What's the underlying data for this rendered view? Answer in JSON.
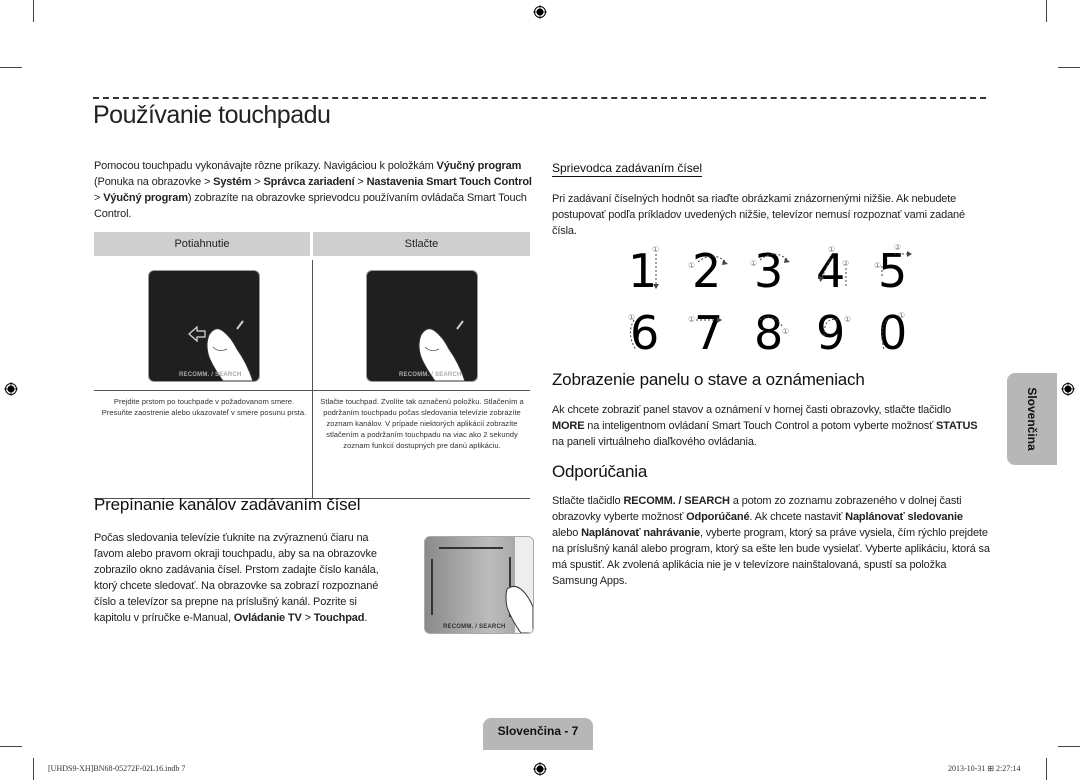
{
  "page": {
    "title": "Používanie touchpadu",
    "intro": {
      "parts": [
        {
          "t": "Pomocou touchpadu vykonávajte rôzne príkazy. Navigáciou k položkám ",
          "b": false
        },
        {
          "t": "Výučný program",
          "b": true
        },
        {
          "t": " (Ponuka na obrazovke > ",
          "b": false
        },
        {
          "t": "Systém",
          "b": true
        },
        {
          "t": " > ",
          "b": false
        },
        {
          "t": "Správca zariadení",
          "b": true
        },
        {
          "t": " > ",
          "b": false
        },
        {
          "t": "Nastavenia Smart Touch Control",
          "b": true
        },
        {
          "t": " > ",
          "b": false
        },
        {
          "t": "Výučný program",
          "b": true
        },
        {
          "t": ") zobrazíte na obrazovke sprievodcu používaním ovládača Smart Touch Control.",
          "b": false
        }
      ]
    },
    "gesture_table": {
      "headers": [
        "Potiahnutie",
        "Stlačte"
      ],
      "pad_label": "RECOMM. / SEARCH",
      "descriptions": [
        "Prejdite prstom po touchpade v požadovanom smere. Presuňte zaostrenie alebo ukazovateľ v smere posunu prsta.",
        "Stlačte touchpad. Zvolíte tak označenú položku. Stlačením a podržaním touchpadu počas sledovania televízie zobrazíte zoznam kanálov. V prípade niektorých aplikácií zobrazíte stlačením a podržaním touchpadu na viac ako 2 sekundy zoznam funkcií dostupných pre danú aplikáciu."
      ]
    },
    "channel_section": {
      "heading": "Prepínanie kanálov zadávaním čísel",
      "parts": [
        {
          "t": "Počas sledovania televízie ťuknite na zvýraznenú čiaru na ľavom alebo pravom okraji touchpadu, aby sa na obrazovke zobrazilo okno zadávania čísel. Prstom zadajte číslo kanála, ktorý chcete sledovať. Na obrazovke sa zobrazí rozpoznané číslo a televízor sa prepne na príslušný kanál. Pozrite si kapitolu v príručke e-Manual, ",
          "b": false
        },
        {
          "t": "Ovládanie TV",
          "b": true
        },
        {
          "t": " > ",
          "b": false
        },
        {
          "t": "Touchpad",
          "b": true
        },
        {
          "t": ".",
          "b": false
        }
      ],
      "pad_label": "RECOMM. / SEARCH"
    },
    "number_guide": {
      "heading": "Sprievodca zadávaním čísel",
      "text": "Pri zadávaní číselných hodnôt sa riaďte obrázkami znázornenými nižšie. Ak nebudete postupovať podľa príkladov uvedených nižšie, televízor nemusí rozpoznať vami zadané čísla.",
      "digits": [
        "1",
        "2",
        "3",
        "4",
        "5",
        "6",
        "7",
        "8",
        "9",
        "0"
      ],
      "stroke_markers": [
        "①",
        "②"
      ]
    },
    "status_section": {
      "heading": "Zobrazenie panelu o stave a oznámeniach",
      "parts": [
        {
          "t": "Ak chcete zobraziť panel stavov a oznámení v hornej časti obrazovky, stlačte tlačidlo ",
          "b": false
        },
        {
          "t": "MORE",
          "b": true
        },
        {
          "t": " na inteligentnom ovládaní Smart Touch Control a potom vyberte možnosť ",
          "b": false
        },
        {
          "t": "STATUS",
          "b": true
        },
        {
          "t": " na paneli virtuálneho diaľkového ovládania.",
          "b": false
        }
      ]
    },
    "recommend_section": {
      "heading": "Odporúčania",
      "parts": [
        {
          "t": "Stlačte tlačidlo ",
          "b": false
        },
        {
          "t": "RECOMM. / SEARCH",
          "b": true
        },
        {
          "t": " a potom zo zoznamu zobrazeného v dolnej časti obrazovky vyberte možnosť ",
          "b": false
        },
        {
          "t": "Odporúčané",
          "b": true
        },
        {
          "t": ". Ak chcete nastaviť ",
          "b": false
        },
        {
          "t": "Naplánovať sledovanie",
          "b": true
        },
        {
          "t": " alebo ",
          "b": false
        },
        {
          "t": "Naplánovať nahrávanie",
          "b": true
        },
        {
          "t": ", vyberte program, ktorý sa práve vysiela, čím rýchlo prejdete na príslušný kanál alebo program, ktorý sa ešte len bude vysielať. Vyberte aplikáciu, ktorá sa má spustiť. Ak zvolená aplikácia nie je v televízore nainštalovaná, spustí sa položka Samsung Apps.",
          "b": false
        }
      ]
    },
    "side_tab": "Slovenčina",
    "footer_tab": "Slovenčina - 7",
    "slug_left": "[UHDS9-XH]BN68-05272F-02L16.indb   7",
    "slug_right": "2013-10-31   ⊞ 2:27:14"
  }
}
